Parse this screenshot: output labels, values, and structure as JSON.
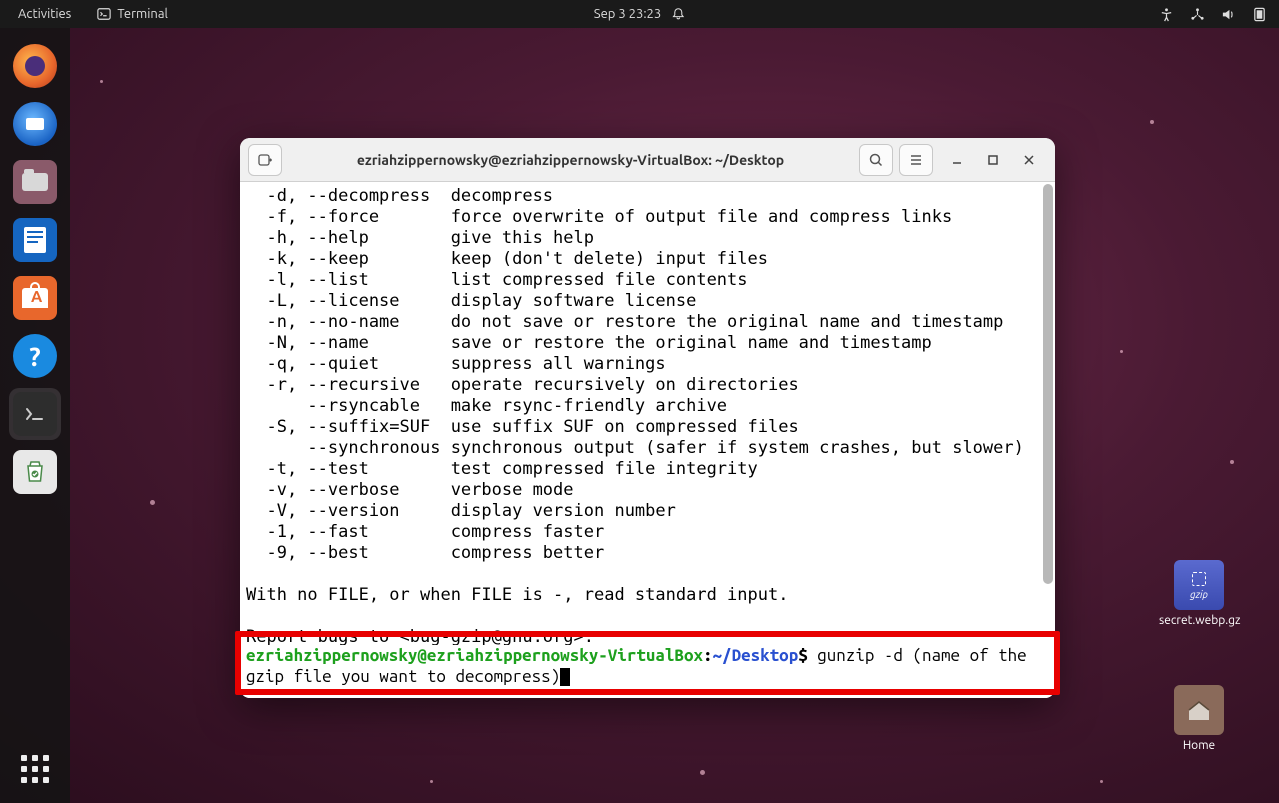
{
  "topbar": {
    "activities": "Activities",
    "app_name": "Terminal",
    "datetime": "Sep 3  23:23"
  },
  "dock": {
    "items": [
      {
        "name": "firefox-icon"
      },
      {
        "name": "thunderbird-icon"
      },
      {
        "name": "files-icon"
      },
      {
        "name": "writer-icon"
      },
      {
        "name": "software-icon"
      },
      {
        "name": "help-icon"
      },
      {
        "name": "terminal-icon"
      },
      {
        "name": "trash-icon"
      }
    ]
  },
  "desktop": {
    "file1_label": "secret.webp.gz",
    "file1_badge": "gzip",
    "home_label": "Home"
  },
  "terminal": {
    "title": "ezriahzippernowsky@ezriahzippernowsky-VirtualBox: ~/Desktop",
    "output": "  -d, --decompress  decompress\n  -f, --force       force overwrite of output file and compress links\n  -h, --help        give this help\n  -k, --keep        keep (don't delete) input files\n  -l, --list        list compressed file contents\n  -L, --license     display software license\n  -n, --no-name     do not save or restore the original name and timestamp\n  -N, --name        save or restore the original name and timestamp\n  -q, --quiet       suppress all warnings\n  -r, --recursive   operate recursively on directories\n      --rsyncable   make rsync-friendly archive\n  -S, --suffix=SUF  use suffix SUF on compressed files\n      --synchronous synchronous output (safer if system crashes, but slower)\n  -t, --test        test compressed file integrity\n  -v, --verbose     verbose mode\n  -V, --version     display version number\n  -1, --fast        compress faster\n  -9, --best        compress better\n\nWith no FILE, or when FILE is -, read standard input.\n\nReport bugs to <bug-gzip@gnu.org>.",
    "prompt": {
      "user": "ezriahzippernowsky",
      "at": "@",
      "host": "ezriahzippernowsky-VirtualBox",
      "colon": ":",
      "path": "~/Desktop",
      "dollar": "$ ",
      "command": "gunzip -d (name of the gzip file you want to decompress)"
    }
  }
}
